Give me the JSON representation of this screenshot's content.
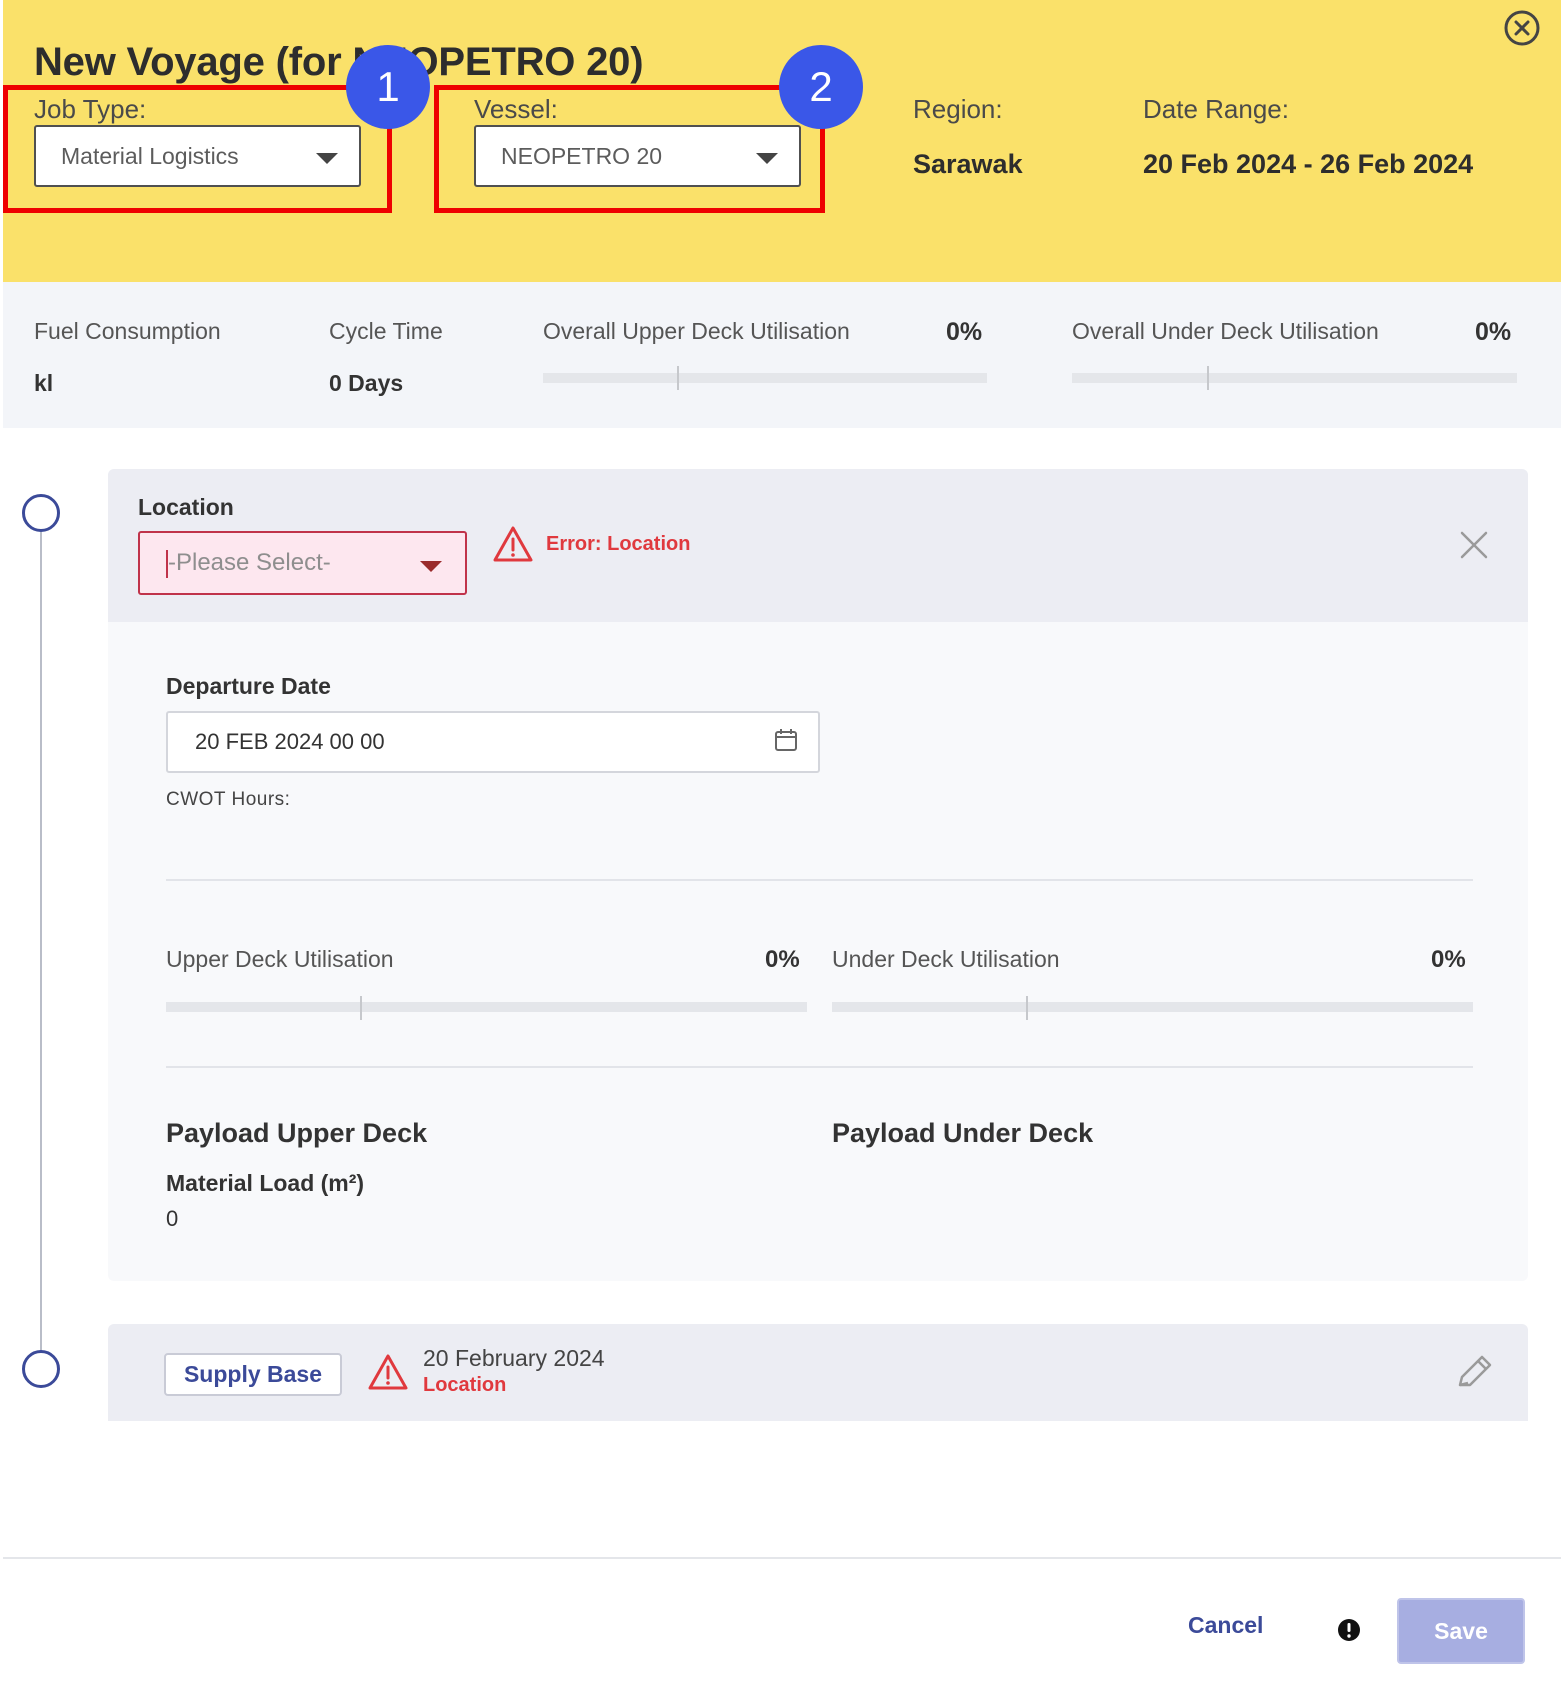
{
  "header": {
    "title": "New Voyage (for NEOPETRO 20)",
    "job_type_label": "Job Type:",
    "job_type_value": "Material Logistics",
    "vessel_label": "Vessel:",
    "vessel_value": "NEOPETRO 20",
    "region_label": "Region:",
    "region_value": "Sarawak",
    "date_range_label": "Date Range:",
    "date_range_value": "20 Feb 2024 - 26 Feb 2024",
    "callouts": [
      "1",
      "2"
    ],
    "close_icon": "circle-close-icon"
  },
  "summary": {
    "fuel_label": "Fuel Consumption",
    "fuel_value": "kl",
    "cycle_label": "Cycle Time",
    "cycle_value": "0 Days",
    "upper_label": "Overall Upper Deck Utilisation",
    "upper_value": "0%",
    "under_label": "Overall Under Deck Utilisation",
    "under_value": "0%"
  },
  "location_card": {
    "location_label": "Location",
    "location_placeholder": "-Please Select-",
    "error_text": "Error: Location",
    "departure_label": "Departure Date",
    "departure_value": "20 FEB 2024 00 00",
    "cwot_label": "CWOT Hours:",
    "upper_util_label": "Upper Deck Utilisation",
    "upper_util_value": "0%",
    "under_util_label": "Under Deck Utilisation",
    "under_util_value": "0%",
    "payload_upper_title": "Payload Upper Deck",
    "payload_under_title": "Payload Under Deck",
    "material_load_label": "Material Load (m²)",
    "material_load_value": "0"
  },
  "supply_card": {
    "tag": "Supply Base",
    "date": "20 February 2024",
    "error_text": "Location"
  },
  "footer": {
    "cancel_label": "Cancel",
    "save_label": "Save"
  },
  "colors": {
    "header_bg": "#fae16a",
    "accent": "#3b4a99",
    "error": "#e0393e",
    "callout_border": "#ee0000",
    "badge": "#3a57e8",
    "save_disabled": "#a7aee1"
  }
}
